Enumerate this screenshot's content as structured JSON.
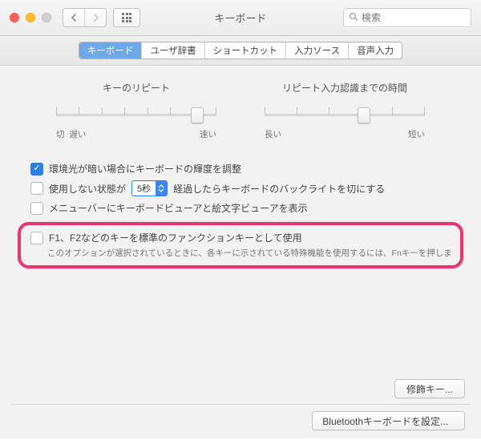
{
  "window": {
    "title": "キーボード"
  },
  "search": {
    "placeholder": "検索"
  },
  "tabs": [
    {
      "label": "キーボード",
      "active": true
    },
    {
      "label": "ユーザ辞書",
      "active": false
    },
    {
      "label": "ショートカット",
      "active": false
    },
    {
      "label": "入力ソース",
      "active": false
    },
    {
      "label": "音声入力",
      "active": false
    }
  ],
  "sliders": {
    "repeat": {
      "title": "キーのリピート",
      "left_label_1": "切",
      "left_label_2": "遅い",
      "right_label": "速い",
      "ticks": 8,
      "knob_pos": 0.88
    },
    "delay": {
      "title": "リピート入力認識までの時間",
      "left_label": "長い",
      "right_label": "短い",
      "ticks": 6,
      "knob_pos": 0.62
    }
  },
  "checks": {
    "brightness": {
      "label": "環境光が暗い場合にキーボードの輝度を調整",
      "checked": true
    },
    "backlight": {
      "prefix": "使用しない状態が",
      "select_value": "5秒",
      "suffix": "経過したらキーボードのバックライトを切にする",
      "checked": false
    },
    "viewers": {
      "label": "メニューバーにキーボードビューアと絵文字ビューアを表示",
      "checked": false
    },
    "fnkeys": {
      "label": "F1、F2などのキーを標準のファンクションキーとして使用",
      "sub": "このオプションが選択されているときに、各キーに示されている特殊機能を使用するには、Fnキーを押します。",
      "checked": false
    }
  },
  "buttons": {
    "modifier": "修飾キー...",
    "bluetooth": "Bluetoothキーボードを設定..."
  }
}
